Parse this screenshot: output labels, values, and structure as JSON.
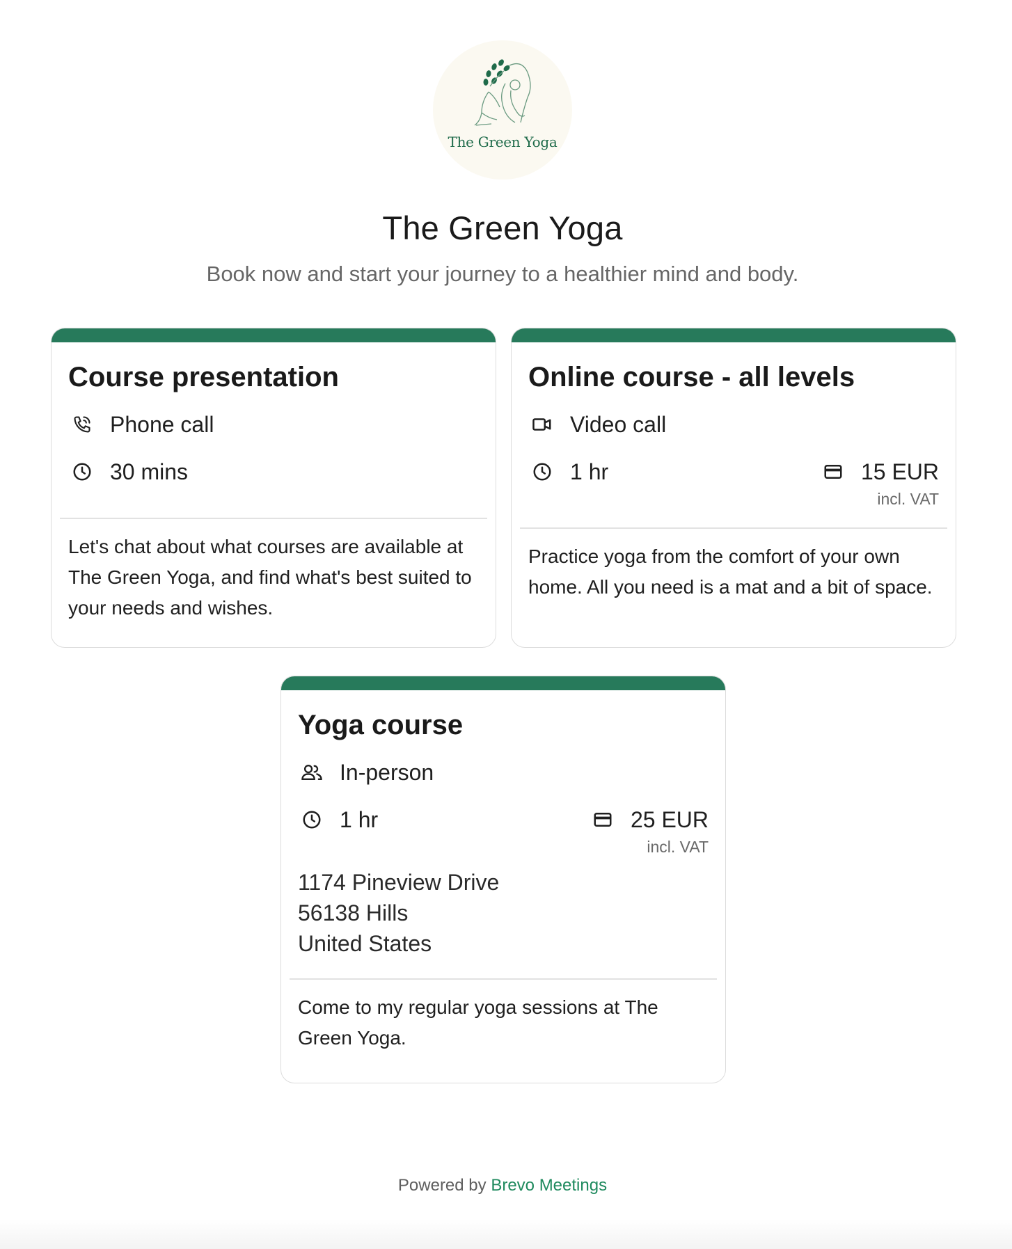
{
  "header": {
    "logo_text": "The Green Yoga",
    "title": "The Green Yoga",
    "subtitle": "Book now and start your journey to a healthier mind and body."
  },
  "colors": {
    "accent": "#277a5b",
    "link": "#1f8a5e"
  },
  "cards": [
    {
      "title": "Course presentation",
      "type_icon": "phone-icon",
      "type_label": "Phone call",
      "duration": "30 mins",
      "description": "Let's chat about what courses are available at The Green Yoga, and find what's best suited to your needs and wishes."
    },
    {
      "title": "Online course - all levels",
      "type_icon": "video-icon",
      "type_label": "Video call",
      "duration": "1 hr",
      "price": "15 EUR",
      "vat": "incl. VAT",
      "description": "Practice yoga from the comfort of your own home. All you need is a mat and a bit of space."
    },
    {
      "title": "Yoga course",
      "type_icon": "people-icon",
      "type_label": "In-person",
      "duration": "1 hr",
      "price": "25 EUR",
      "vat": "incl. VAT",
      "address": {
        "line1": "1174 Pineview Drive",
        "line2": "56138 Hills",
        "line3": "United States"
      },
      "description": "Come to my regular yoga sessions at The Green Yoga."
    }
  ],
  "footer": {
    "prefix": "Powered by",
    "link": "Brevo Meetings"
  }
}
